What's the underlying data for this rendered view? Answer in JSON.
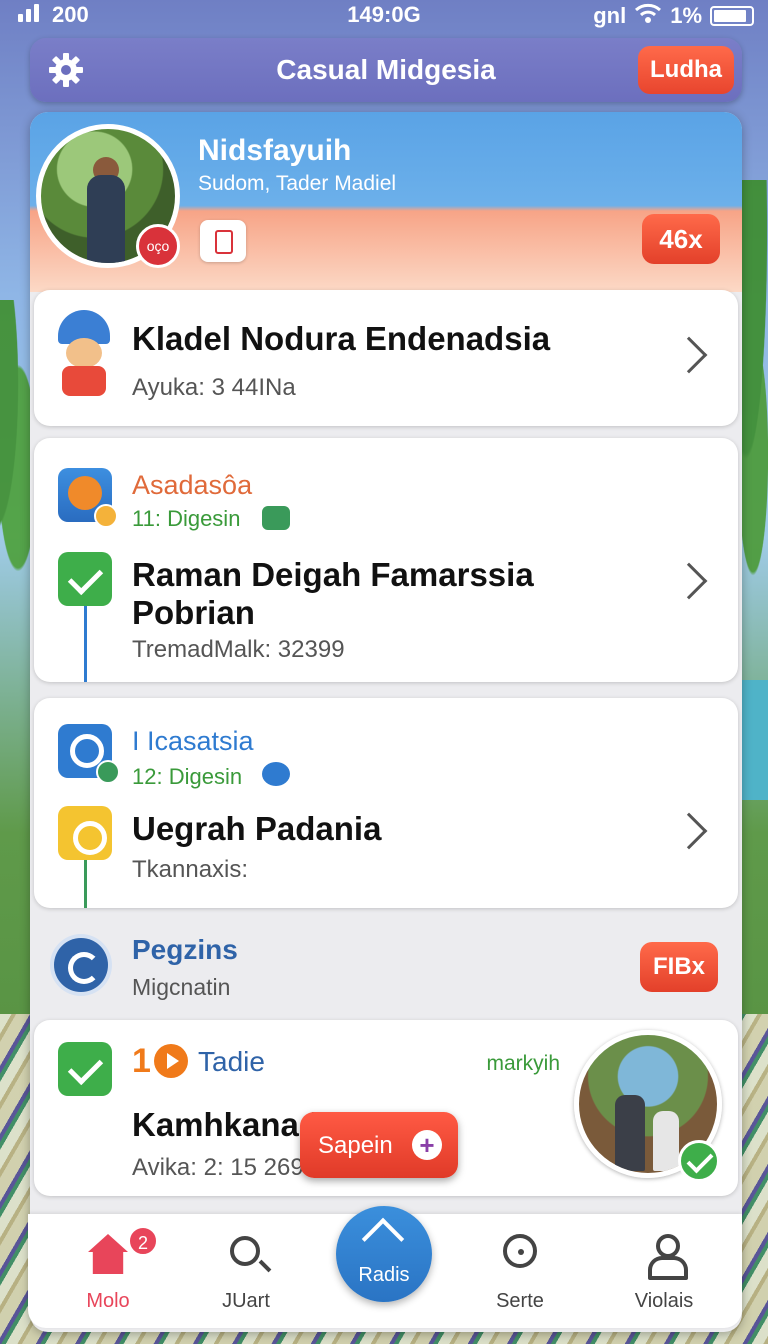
{
  "status_bar": {
    "signal_text": "200",
    "time": "149:0G",
    "carrier": "gnl",
    "battery_text": "1%"
  },
  "header": {
    "title": "Casual Midgesia",
    "action_label": "Ludha"
  },
  "profile": {
    "name": "Nidsfayuih",
    "subtitle": "Sudom, Tader Madiel",
    "avatar_badge": "oço",
    "count_badge": "46x"
  },
  "card1": {
    "title": "Kladel Nodura Endenadsia",
    "meta": "Ayuka: 3 44INa"
  },
  "card2": {
    "section_title": "Asadasôa",
    "section_sub": "11: Digesin",
    "title_line1": "Raman Deigah Famarssia",
    "title_line2": "Pobrian",
    "meta": "TremadMalk: 32399"
  },
  "card3": {
    "section_title": "I Icasatsia",
    "section_sub": "12: Digesin",
    "title": "Uegrah Padania",
    "meta": "Tkannaxis:"
  },
  "plain_section": {
    "title": "Pegzins",
    "sub": "Migcnatin",
    "count_badge": "FIBx"
  },
  "card4": {
    "number": "1",
    "title": "Tadie",
    "right_label": "markyih",
    "headline": "Kamhkanad 2,8:0",
    "meta": "Avika: 2: 15 269"
  },
  "fab": {
    "label": "Sapein",
    "plus": "+"
  },
  "nav": {
    "items": [
      {
        "label": "Molo",
        "badge": "2"
      },
      {
        "label": "JUart"
      },
      {
        "label": "Radis"
      },
      {
        "label": "Serte"
      },
      {
        "label": "Violais"
      }
    ]
  },
  "colors": {
    "accent_red": "#e8452e",
    "accent_blue": "#2f63a8",
    "check_green": "#3eae4a",
    "header_purple": "#7a7ec8"
  }
}
